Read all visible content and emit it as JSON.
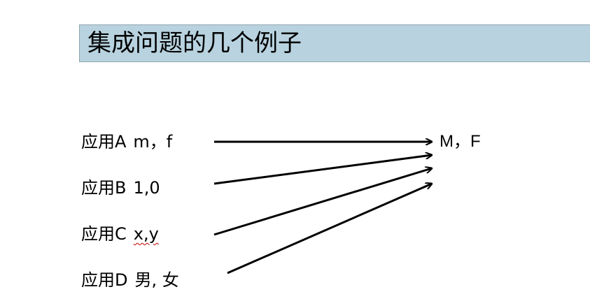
{
  "title": "集成问题的几个例子",
  "sources": [
    {
      "name": "应用A",
      "value": "m，f"
    },
    {
      "name": "应用B",
      "value": "1,0"
    },
    {
      "name": "应用C",
      "value": "x,y"
    },
    {
      "name": "应用D",
      "value": "男, 女"
    }
  ],
  "target": "M，F"
}
